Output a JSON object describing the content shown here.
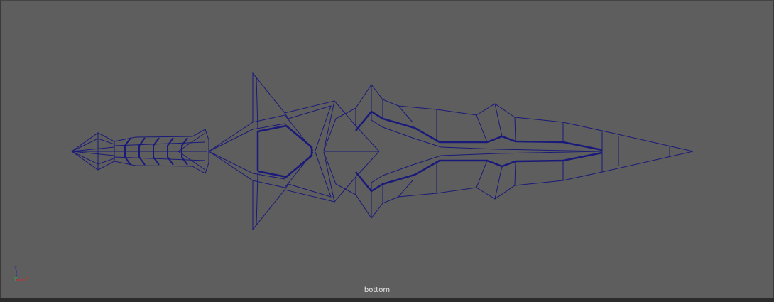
{
  "viewport": {
    "camera_label": "bottom",
    "axis_labels": {
      "z": "z",
      "y": "y",
      "x": "x"
    },
    "wire_color": "#1a1a7a",
    "background_color": "#5e5e5e"
  }
}
